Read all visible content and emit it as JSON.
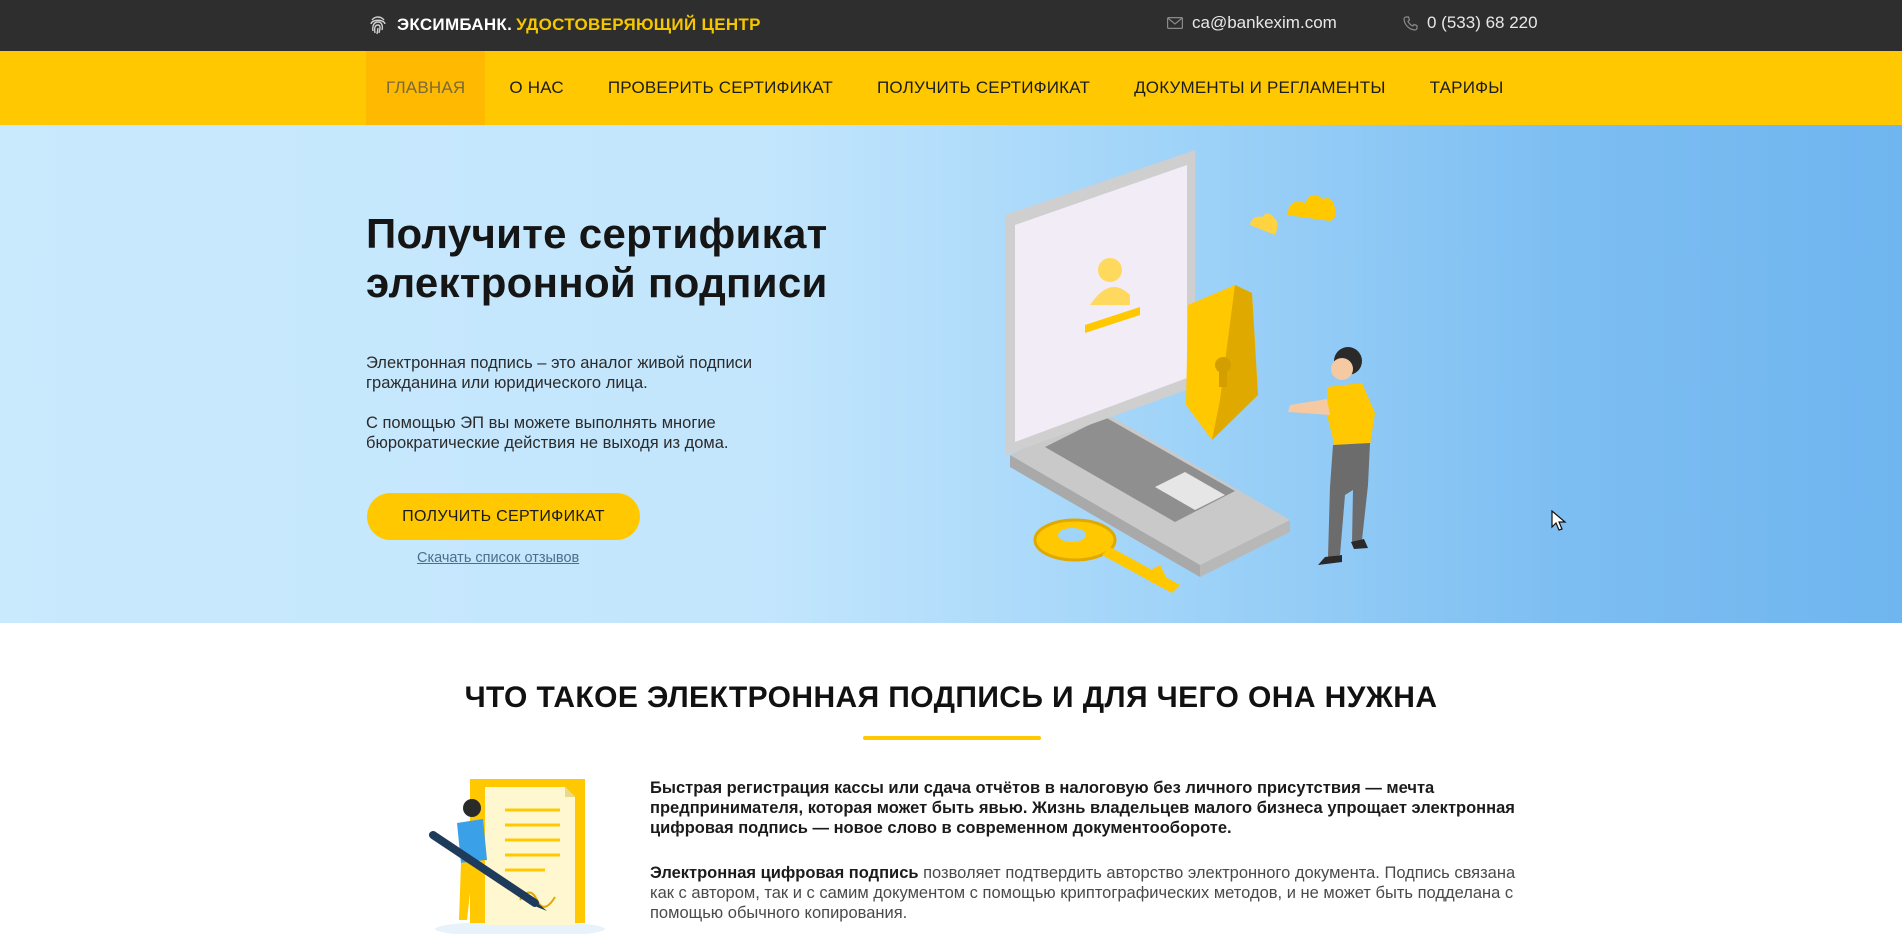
{
  "header": {
    "brand_name": "ЭКСИМБАНК.",
    "brand_sub": "УДОСТОВЕРЯЮЩИЙ ЦЕНТР",
    "email": "ca@bankexim.com",
    "phone": "0 (533) 68 220"
  },
  "nav": {
    "items": [
      {
        "label": "ГЛАВНАЯ",
        "active": true
      },
      {
        "label": "О НАС"
      },
      {
        "label": "ПРОВЕРИТЬ СЕРТИФИКАТ"
      },
      {
        "label": "ПОЛУЧИТЬ СЕРТИФИКАТ"
      },
      {
        "label": "ДОКУМЕНТЫ И РЕГЛАМЕНТЫ"
      },
      {
        "label": "ТАРИФЫ"
      }
    ]
  },
  "hero": {
    "title_line1": "Получите сертификат",
    "title_line2": "электронной подписи",
    "p1": "Электронная подпись – это аналог живой подписи гражданина или юридического лица.",
    "p2": "С помощью ЭП вы можете выполнять многие бюрократические действия не выходя из дома.",
    "cta_label": "ПОЛУЧИТЬ СЕРТИФИКАТ",
    "reviews_link": "Скачать список отзывов"
  },
  "section": {
    "title": "ЧТО ТАКОЕ ЭЛЕКТРОННАЯ ПОДПИСЬ И ДЛЯ ЧЕГО ОНА НУЖНА",
    "lead": "Быстрая регистрация кассы или сдача отчётов в налоговую без личного присутствия — мечта предпринимателя, которая может быть явью. Жизнь владельцев малого бизнеса упрощает электронная цифровая подпись — новое слово в современном документообороте.",
    "body_bold": "Электронная цифровая подпись",
    "body_rest": " позволяет подтвердить авторство электронного документа. Подпись связана как с автором, так и с самим документом с помощью криптографических методов, и не может быть подделана с помощью обычного копирования."
  },
  "colors": {
    "topbar": "#2e2e2e",
    "accent_yellow": "#ffc800",
    "brand_sub": "#f6c600",
    "hero_left": "#c9e9fd",
    "hero_right": "#6fb5ef"
  },
  "icons": {
    "brand": "fingerprint-icon",
    "email": "envelope-icon",
    "phone": "phone-icon"
  }
}
